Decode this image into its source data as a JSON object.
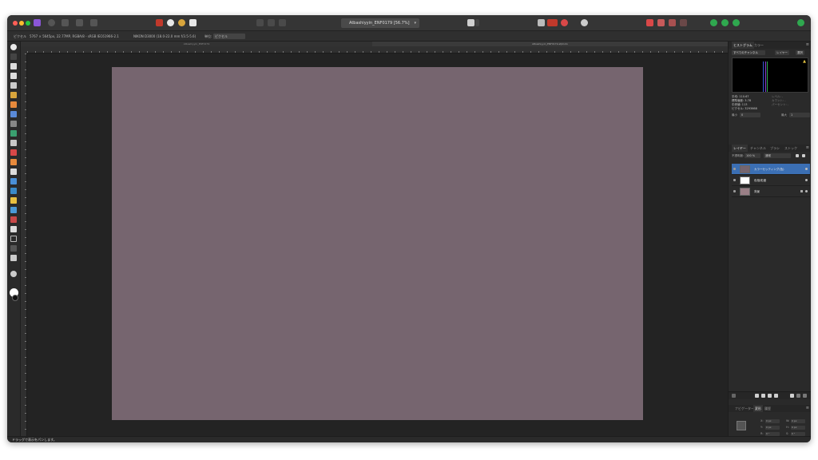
{
  "document": {
    "dropdown_title": "Atbashiyyin_ENF0179 [56.7%]",
    "tab_inactive": "Atbashiyyin_ENF0179",
    "tab_active": "Atbashiyyin_ENF0179.afphoto"
  },
  "context_bar": {
    "label": "ピクセル",
    "size": "5767 × 5645px, 22.77MP, RGBA/8 - sRGB IEC61966-2.1",
    "camera": "NIKON D3000 (18.0-22.0 mm f/3.5-5.6)",
    "unit_label": "単位:",
    "unit_value": "ピクセル"
  },
  "colors": {
    "canvas_fill": "#76656f",
    "selection": "#3b6fb4",
    "swatch_fg": "#ffffff",
    "swatch_bg": "#111111"
  },
  "histogram_panel": {
    "tabs": [
      "ヒストグラム",
      "カラー"
    ],
    "channel": "すべてのチャンネル",
    "buttons": [
      "レイヤー",
      "選択"
    ],
    "stats_left": [
      "平均: 110.67",
      "標準偏差: 3.78",
      "中央値: 113",
      "ピクセル: 3293668"
    ],
    "stats_right": [
      "レベル: -",
      "カウント: -",
      "パーセント: -"
    ],
    "from_label": "最小",
    "from_value": "0",
    "to_label": "最大",
    "to_value": "1"
  },
  "layers_panel": {
    "tabs": [
      "レイヤー",
      "チャンネル",
      "ブラシ",
      "ストック"
    ],
    "opacity_label": "不透明度:",
    "opacity_value": "100 %",
    "blend_mode": "通常",
    "layers": [
      {
        "name": "カラーセッティング(色)",
        "thumb": "#76656f"
      },
      {
        "name": "色相/彩度",
        "thumb": "#ffffff"
      },
      {
        "name": "背景",
        "thumb": "#9a7f86"
      }
    ]
  },
  "bottom_panel": {
    "tabs": [
      "ナビゲーター",
      "変形",
      "履歴"
    ],
    "fields": [
      {
        "label": "X:",
        "value": "0 px"
      },
      {
        "label": "W:",
        "value": "0 px"
      },
      {
        "label": "Y:",
        "value": "0 px"
      },
      {
        "label": "H:",
        "value": "0 px"
      },
      {
        "label": "R:",
        "value": "0 °"
      },
      {
        "label": "S:",
        "value": "0 °"
      }
    ]
  },
  "status_bar": {
    "text": "ドラッグで表示をパンします。"
  }
}
